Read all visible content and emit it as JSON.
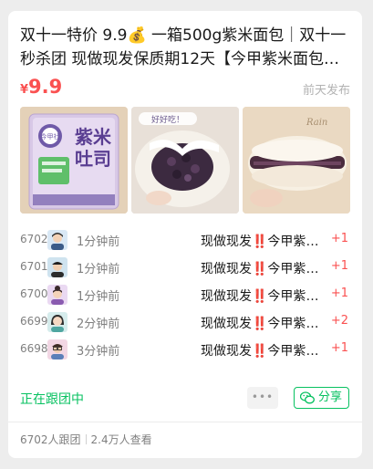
{
  "post": {
    "title": "双十一特价 9.9💰 一箱500g紫米面包｜双十一秒杀团 现做现发保质期12天【今甲紫米面包🫘…",
    "currency": "¥",
    "price": "9.9",
    "posted": "前天发布"
  },
  "images": [
    {
      "icon": "purple-rice-bread-package",
      "brand": "今甲社",
      "text_top": "紫米",
      "text_bottom": "吐司"
    },
    {
      "icon": "bread-with-purple-filling",
      "banner": "好好吃！"
    },
    {
      "icon": "bread-cross-section"
    }
  ],
  "orders": [
    {
      "id": "6702",
      "time": "1分钟前",
      "product": "现做现发‼️今甲紫米面包",
      "qty": "+1",
      "avatar": "avatar-woman-short-hair"
    },
    {
      "id": "6701",
      "time": "1分钟前",
      "product": "现做现发‼️今甲紫米面包",
      "qty": "+1",
      "avatar": "avatar-man-cap"
    },
    {
      "id": "6700",
      "time": "1分钟前",
      "product": "现做现发‼️今甲紫米面包",
      "qty": "+1",
      "avatar": "avatar-woman-bun"
    },
    {
      "id": "6699",
      "time": "2分钟前",
      "product": "现做现发‼️今甲紫米面包",
      "qty": "+2",
      "avatar": "avatar-woman-long-hair"
    },
    {
      "id": "6698",
      "time": "3分钟前",
      "product": "现做现发‼️今甲紫米面包",
      "qty": "+1",
      "avatar": "avatar-man-glasses"
    }
  ],
  "actions": {
    "status": "正在跟团中",
    "more": "•••",
    "share": "分享"
  },
  "stats": {
    "participants": "6702人跟团",
    "views": "2.4万人查看"
  },
  "colors": {
    "price": "#fa5151",
    "accent_green": "#07c160",
    "muted": "#7f7f7f"
  }
}
